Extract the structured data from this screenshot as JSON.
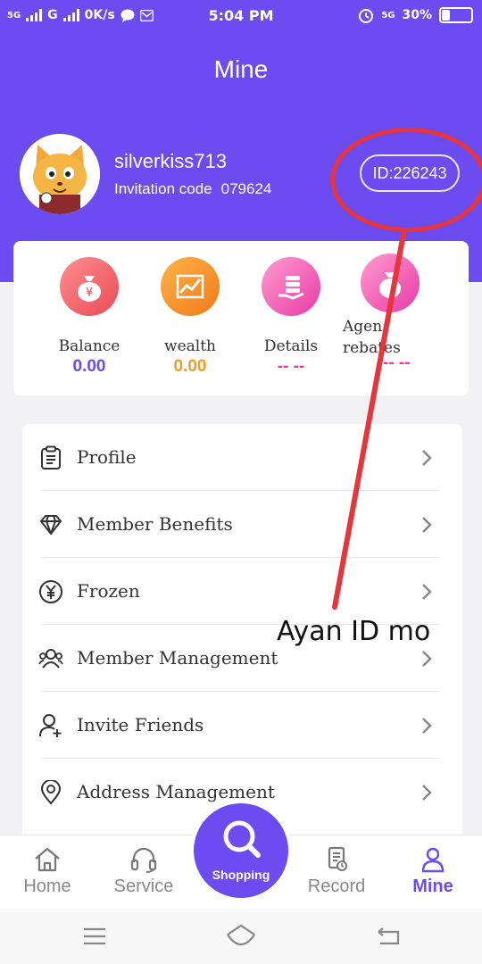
{
  "status_bar": {
    "network_left": "5G",
    "network_mid": "G",
    "speed": "0K/s",
    "time": "5:04 PM",
    "network_right": "5G",
    "battery": "30%"
  },
  "header": {
    "title": "Mine",
    "username": "silverkiss713",
    "invitation_label": "Invitation code",
    "invitation_code": "079624",
    "id_label": "ID:226243"
  },
  "stats": [
    {
      "label": "Balance",
      "value": "0.00",
      "color": "#6a4cf0"
    },
    {
      "label": "wealth",
      "value": "0.00",
      "color": "#f0a020"
    },
    {
      "label": "Details",
      "value": "-- --",
      "color": "#e83aa6"
    },
    {
      "label": "Agen",
      "label2": "rebates",
      "value": "-- --",
      "color": "#e83aa6"
    }
  ],
  "menu": [
    {
      "label": "Profile",
      "icon": "clipboard-icon"
    },
    {
      "label": "Member Benefits",
      "icon": "diamond-icon"
    },
    {
      "label": "Frozen",
      "icon": "yen-circle-icon"
    },
    {
      "label": "Member Management",
      "icon": "members-icon"
    },
    {
      "label": "Invite Friends",
      "icon": "add-user-icon"
    },
    {
      "label": "Address Management",
      "icon": "location-pin-icon"
    }
  ],
  "annotation": "Ayan ID mo",
  "tabs": {
    "home": "Home",
    "service": "Service",
    "shopping": "Shopping",
    "record": "Record",
    "mine": "Mine"
  },
  "colors": {
    "brand": "#6a4cf0",
    "annotation_red": "#e8343b"
  }
}
